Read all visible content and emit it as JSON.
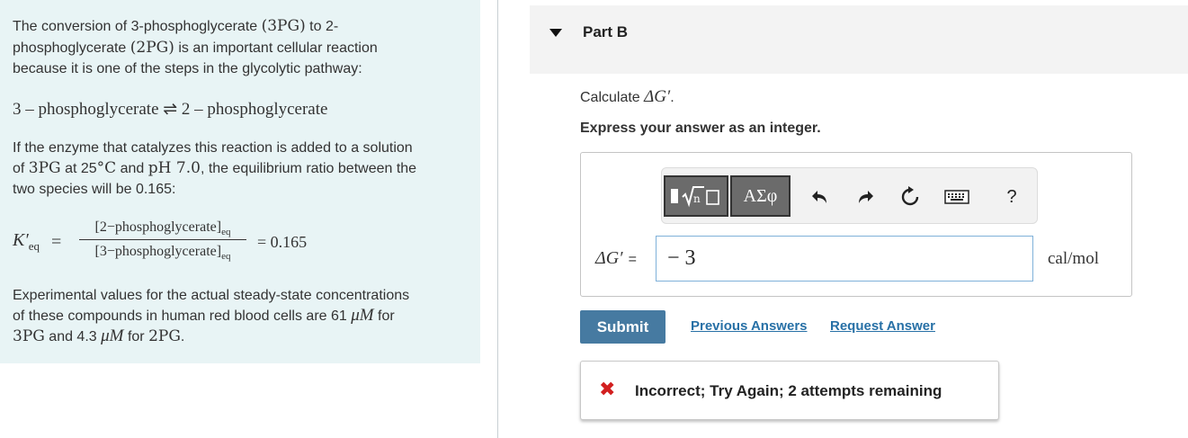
{
  "problem": {
    "intro": {
      "part1": "The conversion of 3-phosphoglycerate ",
      "math1": "(3PG)",
      "part2": " to 2-",
      "line2_part1": "phosphoglycerate ",
      "math2": "(2PG)",
      "line2_part2": " is an important cellular reaction",
      "line3": "because it is one of the steps in the glycolytic pathway:"
    },
    "reaction": "3 – phosphoglycerate ⇌ 2 – phosphoglycerate",
    "enzyme": {
      "line1": "If the enzyme that catalyzes this reaction is added to a solution",
      "line2_a": "of ",
      "line2_m1": "3PG",
      "line2_b": " at 25",
      "line2_m2": "°C",
      "line2_c": " and ",
      "line2_m3": "pH 7.0",
      "line2_d": ", the equilibrium ratio between the",
      "line3": "two species will be 0.165:"
    },
    "keq": {
      "lhs": "K′",
      "lhs_sub": "eq",
      "equals": "=",
      "numerator": "[2−phosphoglycerate]",
      "denominator": "[3−phosphoglycerate]",
      "sub": "eq",
      "rhs": "= 0.165"
    },
    "experimental": {
      "line1": "Experimental values for the actual steady-state concentrations",
      "line2_a": "of these compounds in human red blood cells are 61 ",
      "line2_m": "μM",
      "line2_b": " for",
      "line3_m1": "3PG",
      "line3_a": " and 4.3 ",
      "line3_m2": "μM",
      "line3_b": " for ",
      "line3_m3": "2PG",
      "line3_c": "."
    }
  },
  "part": {
    "title": "Part B",
    "calc_prefix": "Calculate ",
    "calc_math": "ΔG′",
    "calc_suffix": ".",
    "instruction": "Express your answer as an integer."
  },
  "answer": {
    "label": "ΔG′",
    "equals": "=",
    "value": "− 3",
    "unit": "cal/mol"
  },
  "toolbar": {
    "greek_label": "ΑΣφ",
    "help_label": "?"
  },
  "actions": {
    "submit": "Submit",
    "previous": "Previous Answers",
    "request": "Request Answer"
  },
  "feedback": {
    "icon": "✖",
    "text": "Incorrect; Try Again; 2 attempts remaining"
  },
  "colors": {
    "left_panel_bg": "#e8f4f5",
    "submit_bg": "#467aa1",
    "link": "#2770a6",
    "error": "#d21f1f"
  }
}
